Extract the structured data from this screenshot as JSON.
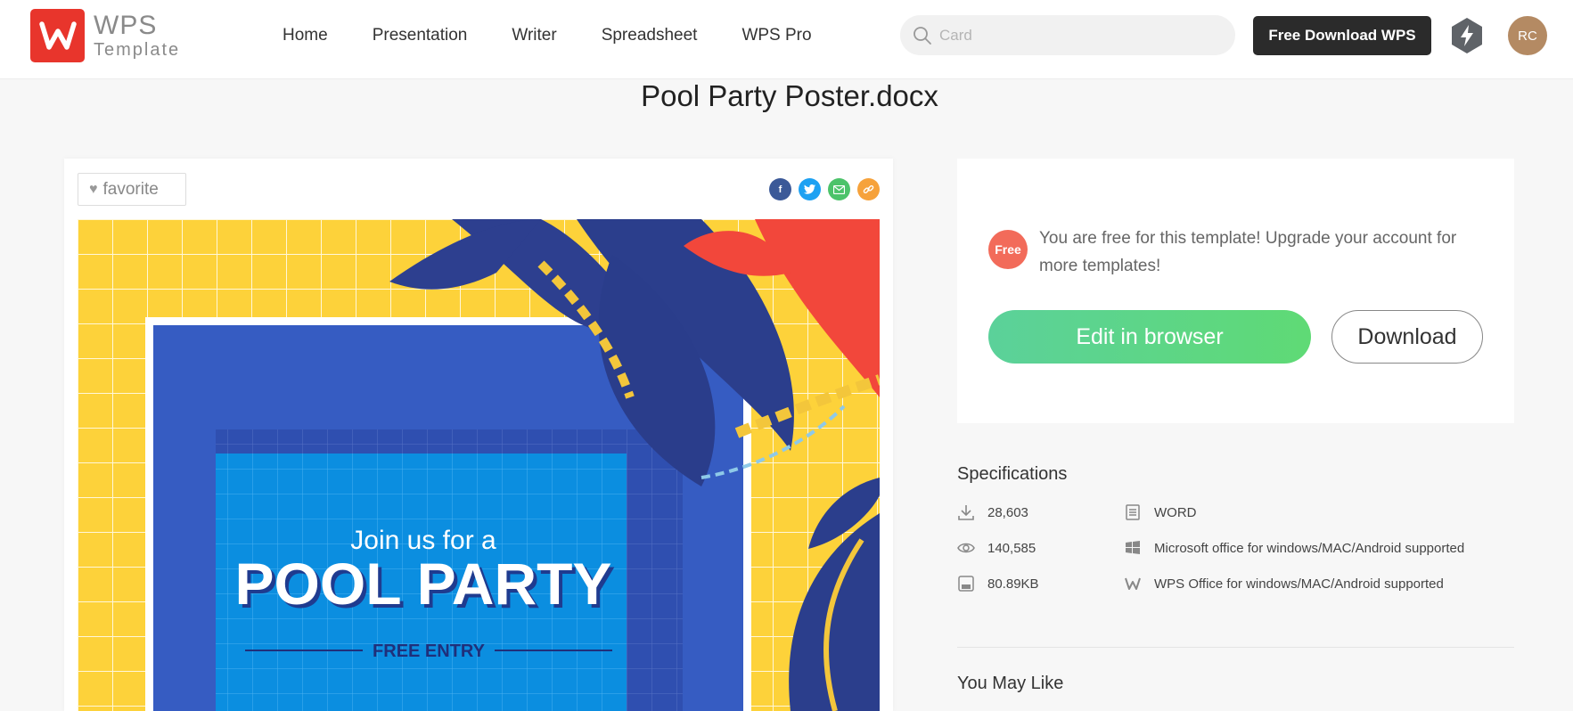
{
  "header": {
    "logo": {
      "line1": "WPS",
      "line2": "Template"
    },
    "nav": [
      "Home",
      "Presentation",
      "Writer",
      "Spreadsheet",
      "WPS Pro"
    ],
    "search_placeholder": "Card",
    "download_wps_label": "Free Download WPS",
    "avatar_initials": "RC"
  },
  "page_title": "Pool Party Poster.docx",
  "preview": {
    "favorite_label": "favorite",
    "share": [
      {
        "icon": "facebook-icon",
        "glyph": "f",
        "color": "#3b5998"
      },
      {
        "icon": "twitter-icon",
        "glyph": "t",
        "color": "#1da1f2"
      },
      {
        "icon": "email-icon",
        "glyph": "✉",
        "color": "#4cc36a"
      },
      {
        "icon": "link-icon",
        "glyph": "🔗",
        "color": "#f6a23b"
      }
    ],
    "poster": {
      "line1": "Join us for a",
      "line2": "POOL PARTY",
      "line3": "FREE ENTRY"
    }
  },
  "panel": {
    "free_badge": "Free",
    "free_message": "You are free for this template! Upgrade your account for more templates!",
    "edit_label": "Edit in browser",
    "download_label": "Download"
  },
  "specifications": {
    "title": "Specifications",
    "downloads": "28,603",
    "views": "140,585",
    "size": "80.89KB",
    "format": "WORD",
    "ms_support": "Microsoft office for windows/MAC/Android supported",
    "wps_support": "WPS Office for windows/MAC/Android supported"
  },
  "you_may_like": "You May Like",
  "colors": {
    "brand_red": "#e8352c",
    "edit_green": "#5bd19a",
    "pool_blue": "#0b8ee0",
    "poster_yellow": "#fdd23a"
  }
}
